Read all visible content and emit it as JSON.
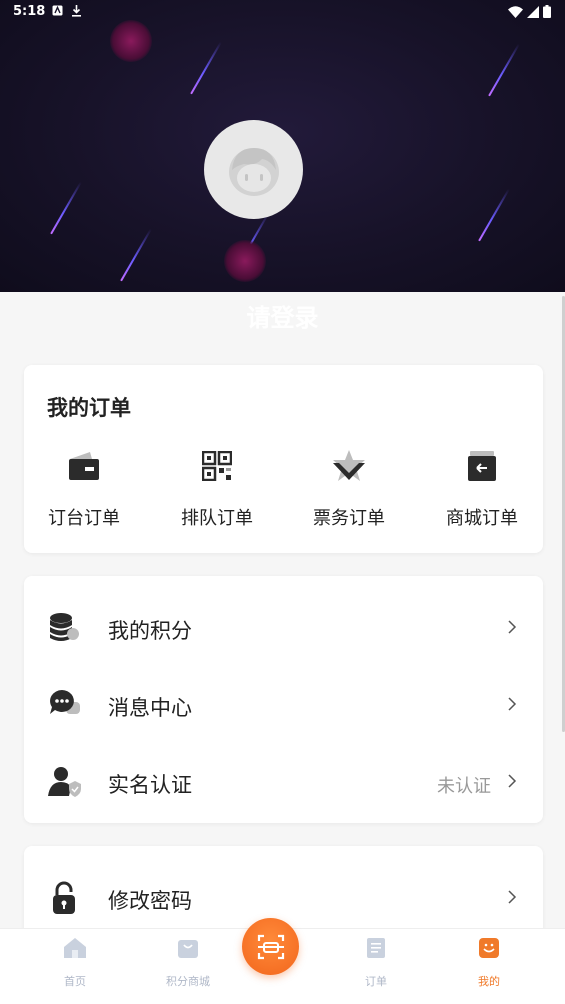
{
  "status_bar": {
    "time": "5:18"
  },
  "header": {
    "login_text": "请登录"
  },
  "orders": {
    "title": "我的订单",
    "items": [
      {
        "label": "订台订单",
        "icon": "wallet-icon"
      },
      {
        "label": "排队订单",
        "icon": "qr-code-icon"
      },
      {
        "label": "票务订单",
        "icon": "star-check-icon"
      },
      {
        "label": "商城订单",
        "icon": "box-return-icon"
      }
    ]
  },
  "menu": {
    "items": [
      {
        "label": "我的积分",
        "value": "",
        "icon": "coins-icon"
      },
      {
        "label": "消息中心",
        "value": "",
        "icon": "chat-icon"
      },
      {
        "label": "实名认证",
        "value": "未认证",
        "icon": "user-verify-icon"
      }
    ]
  },
  "menu2": {
    "items": [
      {
        "label": "修改密码",
        "value": "",
        "icon": "lock-icon"
      }
    ]
  },
  "tabbar": {
    "tabs": [
      {
        "label": "首页",
        "icon": "home-icon",
        "active": false
      },
      {
        "label": "积分商城",
        "icon": "shopping-bag-icon",
        "active": false
      },
      {
        "label": "",
        "icon": "scan-icon",
        "active": false
      },
      {
        "label": "订单",
        "icon": "document-icon",
        "active": false
      },
      {
        "label": "我的",
        "icon": "profile-icon",
        "active": true
      }
    ]
  },
  "colors": {
    "accent": "#f07a2a",
    "hero_bg": "#171228",
    "tab_inactive": "#b0b8c8"
  }
}
